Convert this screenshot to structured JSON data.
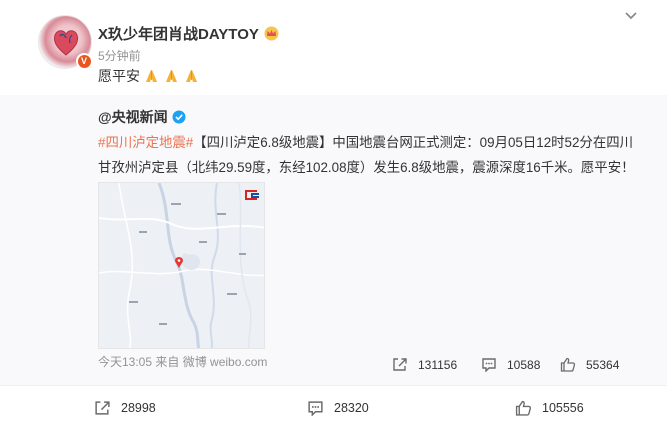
{
  "post": {
    "username": "X玖少年团肖战DAYTOY",
    "time": "5分钟前",
    "text": "愿平安",
    "emoji": [
      "pray-emoji",
      "pray-emoji",
      "pray-emoji"
    ]
  },
  "repost": {
    "author": "@央视新闻",
    "topic": "#四川泸定地震#",
    "text": "【四川泸定6.8级地震】中国地震台网正式测定：09月05日12时52分在四川甘孜州泸定县（北纬29.59度，东经102.08度）发生6.8级地震，震源深度16千米。愿平安！",
    "meta": "今天13:05 来自 微博 weibo.com",
    "actions": {
      "repost_count": "131156",
      "comment_count": "10588",
      "like_count": "55364"
    }
  },
  "footer": {
    "repost_count": "28998",
    "comment_count": "28320",
    "like_count": "105556"
  },
  "colors": {
    "topic": "#eb7350",
    "verified_orange": "#e9551e",
    "verified_blue": "#1da1f2",
    "background": "#f2f2f5",
    "repost_bg": "#f9f9fb"
  }
}
